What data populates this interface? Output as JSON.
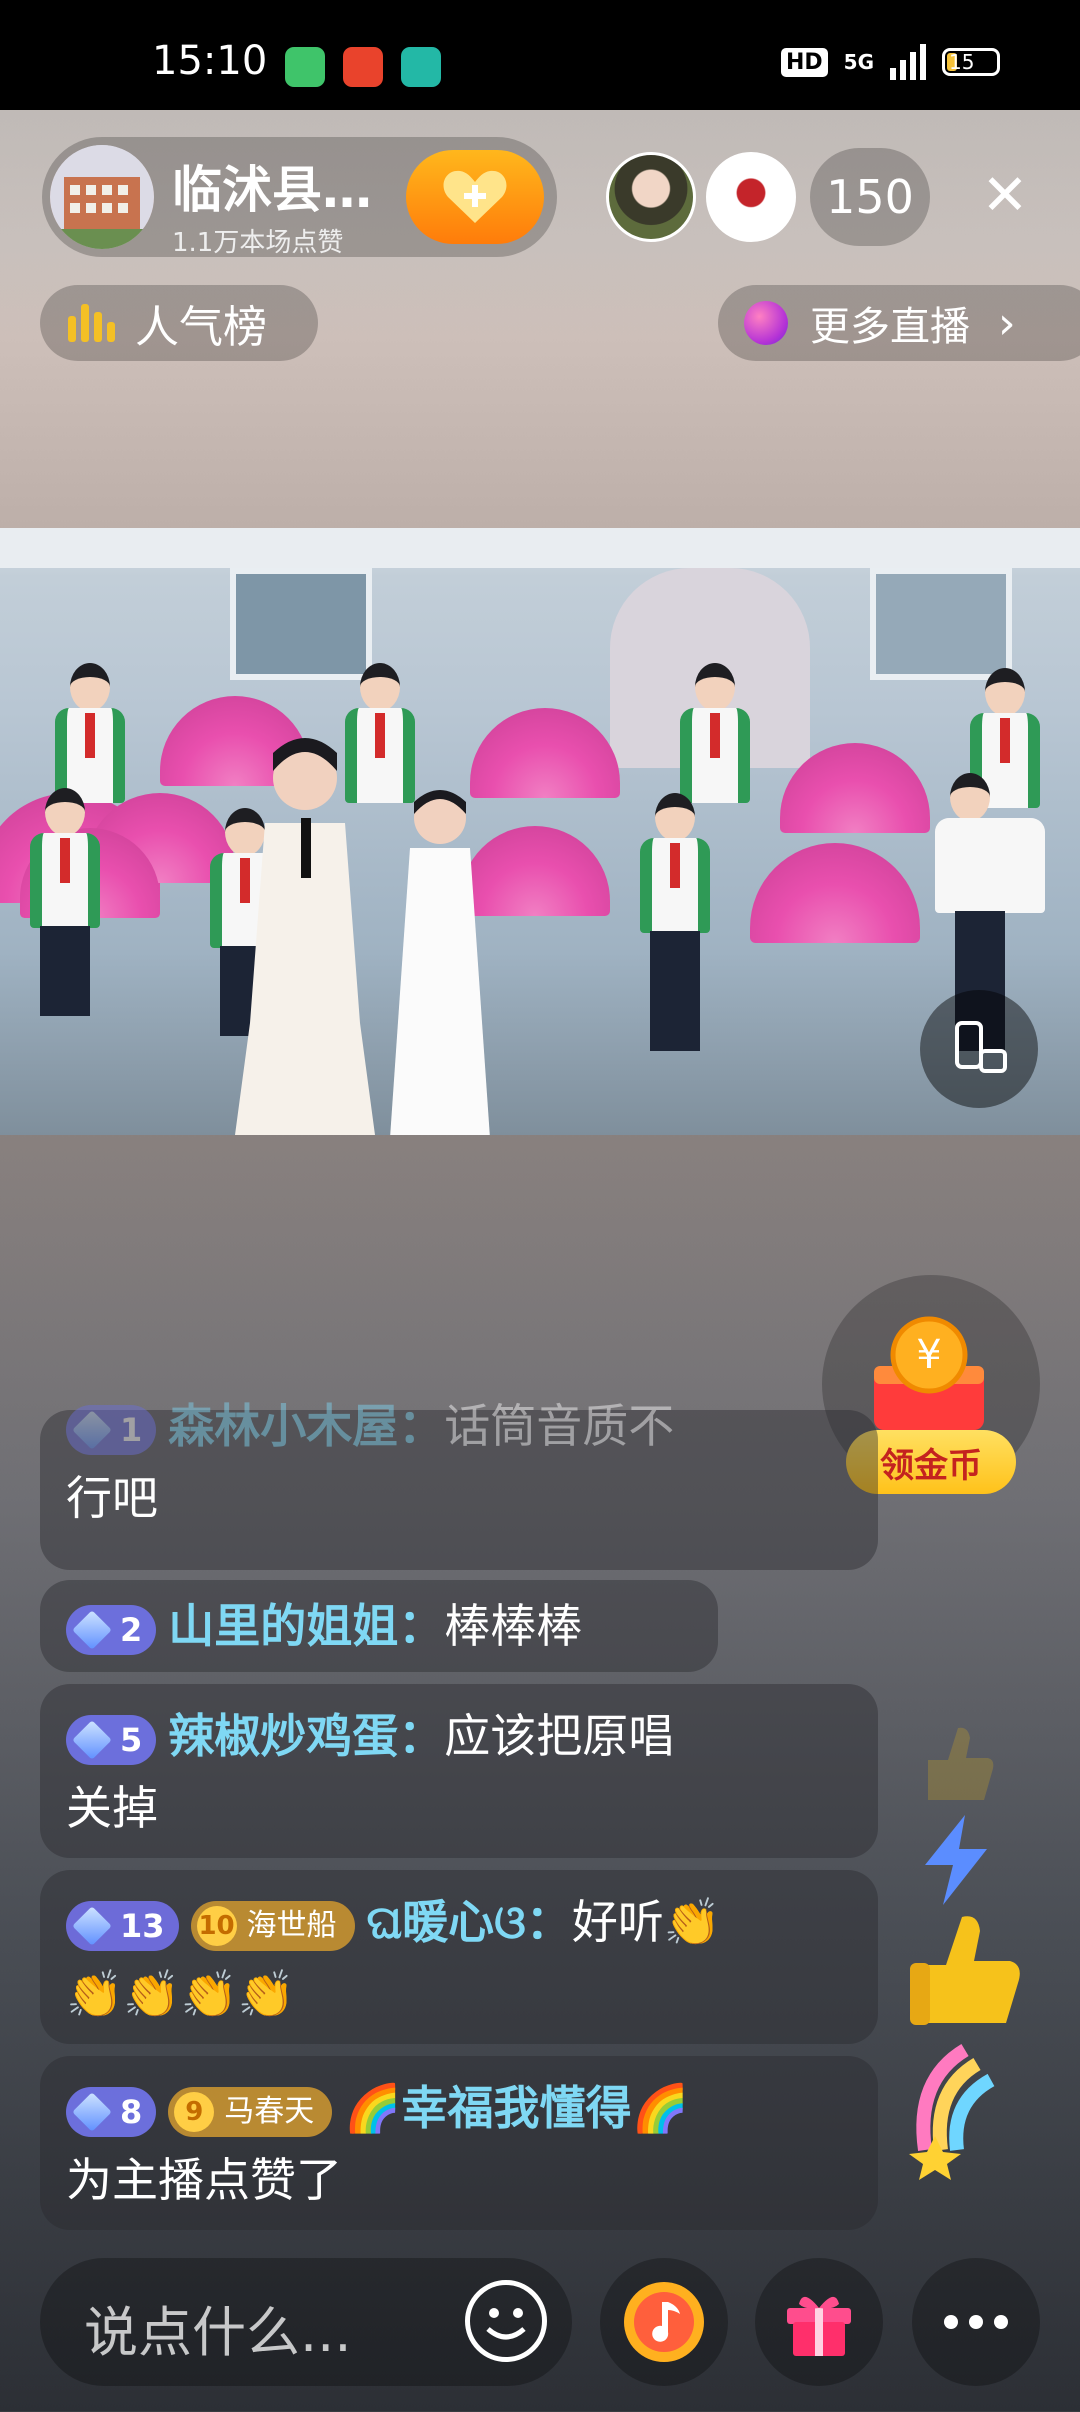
{
  "status_bar": {
    "time": "15:10",
    "hd_label": "HD",
    "network": "5G",
    "battery": "15"
  },
  "anchor": {
    "name": "临沭县…",
    "likes": "1.1万本场点赞",
    "follow_icon": "heart-plus-icon"
  },
  "viewers": {
    "count": "150"
  },
  "rank_button": {
    "label": "人气榜"
  },
  "more_live": {
    "label": "更多直播"
  },
  "gold_coin": {
    "label": "领金币",
    "box_symbol": "¥"
  },
  "comments": [
    {
      "level": "1",
      "user": "森林小木屋：",
      "text": "话筒音质不行吧",
      "text_line1": "话筒音质不",
      "text_line2": "行吧"
    },
    {
      "level": "2",
      "user": "山里的姐姐：",
      "text": "棒棒棒"
    },
    {
      "level": "5",
      "user": "辣椒炒鸡蛋：",
      "text": "应该把原唱关掉",
      "text_line1": "应该把原唱",
      "text_line2": "关掉"
    },
    {
      "level": "13",
      "fan_level": "10",
      "fan_club": "海世船",
      "user": "ଘ暖心ଓ：",
      "text_line1": "好听👏",
      "text_line2": "👏👏👏👏"
    },
    {
      "level": "8",
      "fan_level": "9",
      "fan_club": "马春天",
      "user": "🌈幸福我懂得🌈",
      "text_line2": "为主播点赞了"
    }
  ],
  "bottom_bar": {
    "input_placeholder": "说点什么...",
    "emoji_icon": "emoji-icon",
    "music_icon": "music-note-icon",
    "gift_icon": "gift-icon",
    "more_icon": "more-icon"
  },
  "colors": {
    "accent_orange": "#ff9a14",
    "username_blue": "#7fd8f4",
    "level_purple": "#6c6fdc",
    "fan_gold": "#b98a32"
  }
}
